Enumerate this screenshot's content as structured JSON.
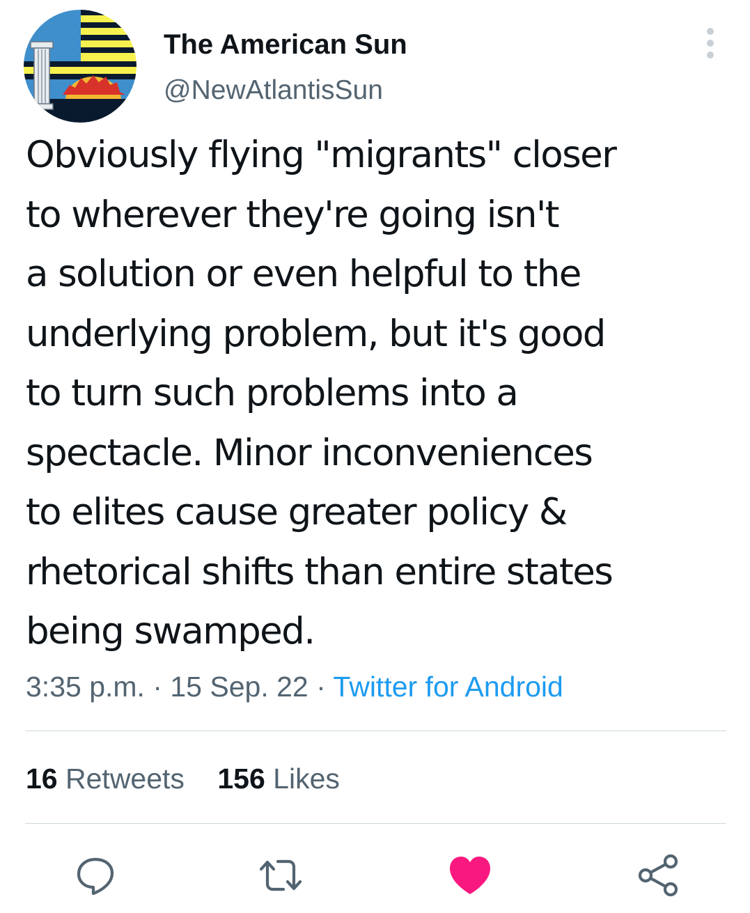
{
  "author": {
    "display_name": "The American Sun",
    "handle": "@NewAtlantisSun"
  },
  "tweet": {
    "text": "Obviously flying \"migrants\" closer\nto wherever they're going isn't\na solution or even helpful to the\nunderlying problem, but it's good\nto turn such problems into a\nspectacle. Minor inconveniences\nto elites cause greater policy &\nrhetorical shifts than entire states\nbeing swamped.",
    "time": "3:35 p.m.",
    "separator": " · ",
    "date": "15 Sep. 22",
    "source": "Twitter for Android"
  },
  "stats": {
    "retweets_count": "16",
    "retweets_label": "Retweets",
    "likes_count": "156",
    "likes_label": "Likes"
  },
  "actions": [
    {
      "name": "reply",
      "icon": "speech-bubble-icon"
    },
    {
      "name": "retweet",
      "icon": "retweet-arrows-icon"
    },
    {
      "name": "like",
      "icon": "heart-icon",
      "liked": true
    },
    {
      "name": "share",
      "icon": "share-nodes-icon"
    }
  ],
  "colors": {
    "secondary_text": "#536471",
    "link": "#1d9bf0",
    "like_active": "#f91880",
    "divider": "#cfd9de"
  }
}
